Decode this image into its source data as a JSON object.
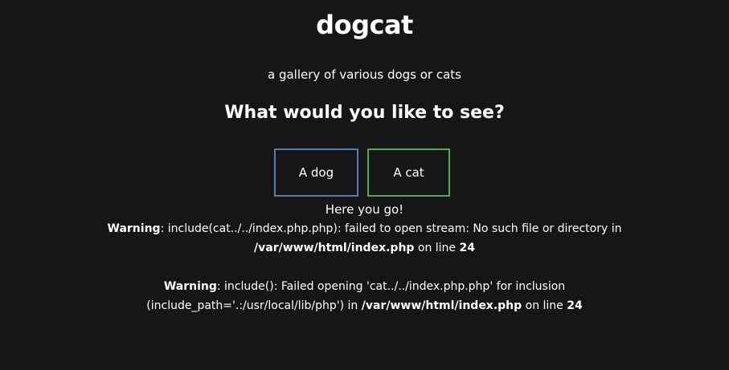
{
  "header": {
    "title": "dogcat",
    "tagline": "a gallery of various dogs or cats"
  },
  "main": {
    "prompt": "What would you like to see?",
    "buttons": {
      "dog": "A dog",
      "cat": "A cat"
    },
    "result_text": "Here you go!"
  },
  "warnings": [
    {
      "label": "Warning",
      "message": ": include(cat../../index.php.php): failed to open stream: No such file or directory in ",
      "path": "/var/www/html/index.php",
      "suffix": " on line ",
      "line": "24"
    },
    {
      "label": "Warning",
      "message": ": include(): Failed opening 'cat../../index.php.php' for inclusion (include_path='.:/usr/local/lib/php') in ",
      "path": "/var/www/html/index.php",
      "suffix": " on line ",
      "line": "24"
    }
  ],
  "colors": {
    "background": "#161616",
    "dog_border": "#4f80b0",
    "cat_border": "#59a659",
    "text": "#ffffff"
  }
}
